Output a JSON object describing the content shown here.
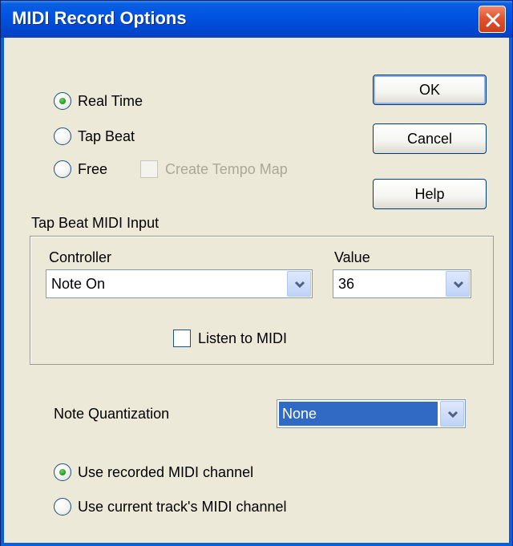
{
  "window": {
    "title": "MIDI Record Options"
  },
  "record_mode": {
    "options": [
      {
        "label": "Real Time",
        "selected": true
      },
      {
        "label": "Tap Beat",
        "selected": false
      },
      {
        "label": "Free",
        "selected": false
      }
    ],
    "create_tempo_map": {
      "label": "Create Tempo Map",
      "checked": false,
      "enabled": false
    }
  },
  "buttons": {
    "ok": "OK",
    "cancel": "Cancel",
    "help": "Help"
  },
  "tap_beat": {
    "group_label": "Tap Beat MIDI Input",
    "controller_label": "Controller",
    "controller_value": "Note On",
    "value_label": "Value",
    "value_value": "36",
    "listen_label": "Listen to MIDI",
    "listen_checked": false
  },
  "quantization": {
    "label": "Note Quantization",
    "value": "None"
  },
  "channel": {
    "options": [
      {
        "label": "Use recorded MIDI channel",
        "selected": true
      },
      {
        "label": "Use current track's MIDI channel",
        "selected": false
      }
    ]
  },
  "colors": {
    "titlebar": "#0054e3",
    "dialog_bg": "#ece9d8",
    "selection": "#316ac5",
    "radio_dot": "#21a121"
  }
}
